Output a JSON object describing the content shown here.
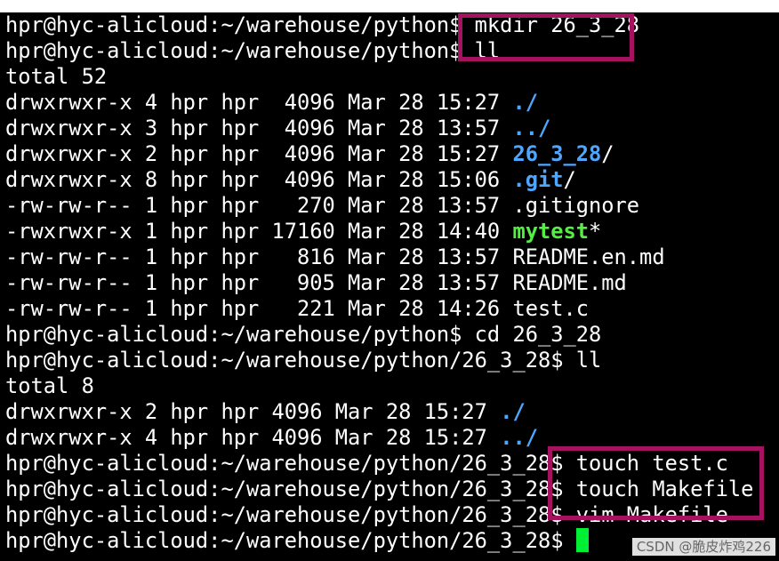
{
  "terminal": {
    "lines": [
      {
        "parts": [
          {
            "t": "hpr@hyc-alicloud:~/warehouse/python$ mkdir 26_3_28"
          }
        ]
      },
      {
        "parts": [
          {
            "t": "hpr@hyc-alicloud:~/warehouse/python$ ll"
          }
        ]
      },
      {
        "parts": [
          {
            "t": "total 52"
          }
        ]
      },
      {
        "parts": [
          {
            "t": "drwxrwxr-x 4 hpr hpr  4096 Mar 28 15:27 "
          },
          {
            "t": "./",
            "c": "dir"
          }
        ]
      },
      {
        "parts": [
          {
            "t": "drwxrwxr-x 3 hpr hpr  4096 Mar 28 13:57 "
          },
          {
            "t": "../",
            "c": "dir"
          }
        ]
      },
      {
        "parts": [
          {
            "t": "drwxrwxr-x 2 hpr hpr  4096 Mar 28 15:27 "
          },
          {
            "t": "26_3_28",
            "c": "dir"
          },
          {
            "t": "/"
          }
        ]
      },
      {
        "parts": [
          {
            "t": "drwxrwxr-x 8 hpr hpr  4096 Mar 28 15:06 "
          },
          {
            "t": ".git",
            "c": "dir"
          },
          {
            "t": "/"
          }
        ]
      },
      {
        "parts": [
          {
            "t": "-rw-rw-r-- 1 hpr hpr   270 Mar 28 13:57 .gitignore"
          }
        ]
      },
      {
        "parts": [
          {
            "t": "-rwxrwxr-x 1 hpr hpr 17160 Mar 28 14:40 "
          },
          {
            "t": "mytest",
            "c": "exec"
          },
          {
            "t": "*"
          }
        ]
      },
      {
        "parts": [
          {
            "t": "-rw-rw-r-- 1 hpr hpr   816 Mar 28 13:57 README.en.md"
          }
        ]
      },
      {
        "parts": [
          {
            "t": "-rw-rw-r-- 1 hpr hpr   905 Mar 28 13:57 README.md"
          }
        ]
      },
      {
        "parts": [
          {
            "t": "-rw-rw-r-- 1 hpr hpr   221 Mar 28 14:26 test.c"
          }
        ]
      },
      {
        "parts": [
          {
            "t": "hpr@hyc-alicloud:~/warehouse/python$ cd 26_3_28"
          }
        ]
      },
      {
        "parts": [
          {
            "t": "hpr@hyc-alicloud:~/warehouse/python/26_3_28$ ll"
          }
        ]
      },
      {
        "parts": [
          {
            "t": "total 8"
          }
        ]
      },
      {
        "parts": [
          {
            "t": "drwxrwxr-x 2 hpr hpr 4096 Mar 28 15:27 "
          },
          {
            "t": "./",
            "c": "dir"
          }
        ]
      },
      {
        "parts": [
          {
            "t": "drwxrwxr-x 4 hpr hpr 4096 Mar 28 15:27 "
          },
          {
            "t": "../",
            "c": "dir"
          }
        ]
      },
      {
        "parts": [
          {
            "t": "hpr@hyc-alicloud:~/warehouse/python/26_3_28$ touch test.c"
          }
        ]
      },
      {
        "parts": [
          {
            "t": "hpr@hyc-alicloud:~/warehouse/python/26_3_28$ touch Makefile"
          }
        ]
      },
      {
        "parts": [
          {
            "t": "hpr@hyc-alicloud:~/warehouse/python/26_3_28$ vim Makefile"
          }
        ]
      },
      {
        "parts": [
          {
            "t": "hpr@hyc-alicloud:~/warehouse/python/26_3_28$ "
          }
        ],
        "cursor": true
      }
    ]
  },
  "colors": {
    "background": "#000000",
    "text": "#ffffff",
    "directory": "#4fa6ff",
    "executable": "#55ee44",
    "cursor": "#00ee33",
    "highlight_box": "#a5125f"
  },
  "watermark": "CSDN @脆皮炸鸡226"
}
